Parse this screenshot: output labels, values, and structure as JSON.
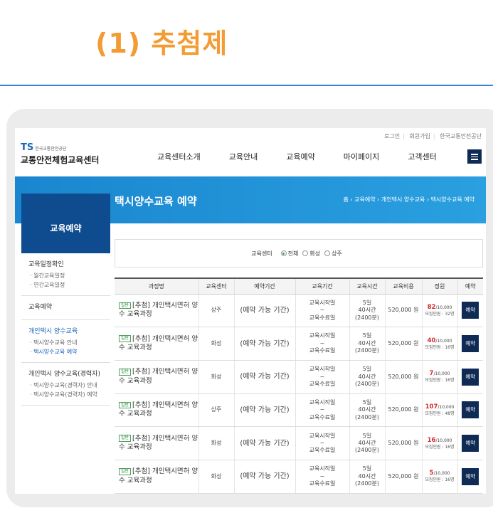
{
  "heading": {
    "title": "(1) 추첨제"
  },
  "util_links": [
    "로그인",
    "회원가입",
    "한국교통안전공단"
  ],
  "logo": {
    "ts": "TS",
    "small": "한국교통안전공단",
    "big": "교통안전체험교육센터"
  },
  "gnb": [
    "교육센터소개",
    "교육안내",
    "교육예약",
    "마이페이지",
    "고객센터"
  ],
  "banner": {
    "title": "택시양수교육 예약",
    "breadcrumb": "홈 › 교육예약 › 개인택시 양수교육 › 택시양수교육 예약"
  },
  "sidebar": {
    "title": "교육예약",
    "groups": [
      {
        "heading": "교육일정확인",
        "items": [
          "· 월간교육일정",
          "· 연간교육일정"
        ]
      },
      {
        "heading": "교육예약",
        "items": []
      },
      {
        "heading": "개인택시 양수교육",
        "items": [
          "· 택시양수교육 안내",
          "· 택시양수교육 예약"
        ]
      },
      {
        "heading": "개인택시 양수교육(경력자)",
        "items": [
          "· 택시양수교육(경력자) 안내",
          "· 택시양수교육(경력자) 예약"
        ]
      }
    ]
  },
  "filter": {
    "label": "교육센터",
    "options": [
      "전체",
      "화성",
      "상주"
    ],
    "selected": "전체"
  },
  "table": {
    "headers": [
      "과정명",
      "교육센터",
      "예약기간",
      "교육기간",
      "교육시간",
      "교육비용",
      "정원",
      "예약"
    ],
    "badge": "일반",
    "rows": [
      {
        "name": "[추첨] 개인택시면허 양수 교육과정",
        "center": "상주",
        "period": "(예약 가능 기간)",
        "edu": [
          "교육시작일",
          "~",
          "교육수료일"
        ],
        "time": [
          "5일",
          "40시간",
          "(2400분)"
        ],
        "cost": "520,000 원",
        "applied": "82",
        "cap": "/10,000",
        "recruit": "모집인원 : 32명",
        "btn": "예약"
      },
      {
        "name": "[추첨] 개인택시면허 양수 교육과정",
        "center": "화성",
        "period": "(예약 가능 기간)",
        "edu": [
          "교육시작일",
          "~",
          "교육수료일"
        ],
        "time": [
          "5일",
          "40시간",
          "(2400분)"
        ],
        "cost": "520,000 원",
        "applied": "40",
        "cap": "/10,000",
        "recruit": "모집인원 : 16명",
        "btn": "예약"
      },
      {
        "name": "[추첨] 개인택시면허 양수 교육과정",
        "center": "화성",
        "period": "(예약 가능 기간)",
        "edu": [
          "교육시작일",
          "~",
          "교육수료일"
        ],
        "time": [
          "5일",
          "40시간",
          "(2400분)"
        ],
        "cost": "520,000 원",
        "applied": "7",
        "cap": "/10,000",
        "recruit": "모집인원 : 16명",
        "btn": "예약"
      },
      {
        "name": "[추첨] 개인택시면허 양수 교육과정",
        "center": "상주",
        "period": "(예약 가능 기간)",
        "edu": [
          "교육시작일",
          "~",
          "교육수료일"
        ],
        "time": [
          "5일",
          "40시간",
          "(2400분)"
        ],
        "cost": "520,000 원",
        "applied": "107",
        "cap": "/10,000",
        "recruit": "모집인원 : 48명",
        "btn": "예약"
      },
      {
        "name": "[추첨] 개인택시면허 양수 교육과정",
        "center": "화성",
        "period": "(예약 가능 기간)",
        "edu": [
          "교육시작일",
          "~",
          "교육수료일"
        ],
        "time": [
          "5일",
          "40시간",
          "(2400분)"
        ],
        "cost": "520,000 원",
        "applied": "16",
        "cap": "/10,000",
        "recruit": "모집인원 : 16명",
        "btn": "예약"
      },
      {
        "name": "[추첨] 개인택시면허 양수 교육과정",
        "center": "화성",
        "period": "(예약 가능 기간)",
        "edu": [
          "교육시작일",
          "~",
          "교육수료일"
        ],
        "time": [
          "5일",
          "40시간",
          "(2400분)"
        ],
        "cost": "520,000 원",
        "applied": "5",
        "cap": "/10,000",
        "recruit": "모집인원 : 16명",
        "btn": "예약"
      }
    ]
  }
}
